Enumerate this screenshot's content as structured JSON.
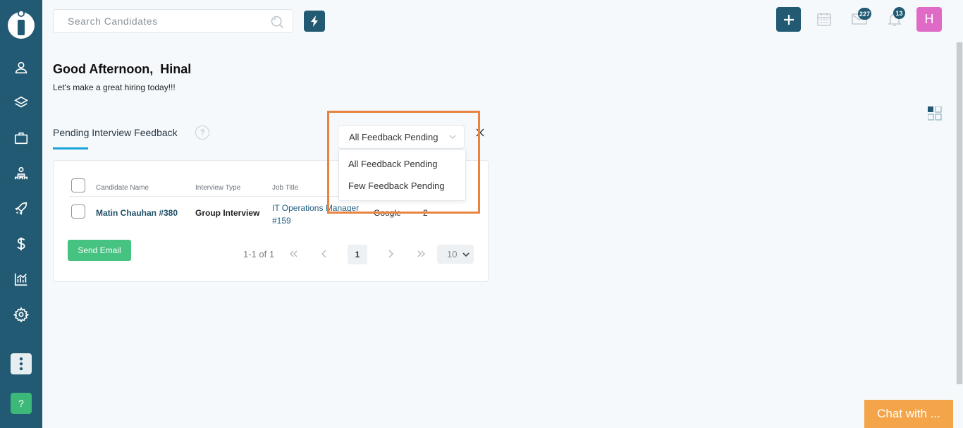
{
  "header": {
    "search_placeholder": "Search Candidates",
    "mail_badge": "227",
    "notification_badge": "13",
    "avatar_initial": "H"
  },
  "greeting": {
    "title": "Good Afternoon,  Hinal",
    "subtitle": "Let's make a great hiring today!!!"
  },
  "widget": {
    "title": "Pending Interview Feedback",
    "info_glyph": "?",
    "filter": {
      "selected": "All Feedback Pending",
      "options": [
        "All Feedback Pending",
        "Few Feedback Pending"
      ]
    },
    "table": {
      "headers": [
        "Candidate Name",
        "Interview Type",
        "Job Title"
      ],
      "rows": [
        {
          "candidate": "Matin Chauhan #380",
          "interview_type": "Group Interview",
          "job_title_line1": "IT Operations Manager",
          "job_title_line2": "#159",
          "company": "Google",
          "count": "2"
        }
      ]
    },
    "send_email_label": "Send Email",
    "pagination": {
      "summary": "1-1 of 1",
      "current_page": "1",
      "per_page": "10"
    }
  },
  "sidebar_help_glyph": "?",
  "chat_label": "Chat with ...",
  "colors": {
    "sidebar": "#215a72",
    "accent_underline": "#1aa3d8",
    "send_button": "#46c281",
    "avatar": "#e06bc6",
    "highlight": "#e8843f",
    "chat": "#f5a549"
  },
  "icons": [
    "app-logo-icon",
    "person-icon",
    "layers-icon",
    "briefcase-icon",
    "team-icon",
    "rocket-icon",
    "dollar-icon",
    "analytics-icon",
    "gear-icon",
    "more-vertical-icon",
    "help-icon",
    "search-icon",
    "bolt-icon",
    "plus-icon",
    "calendar-icon",
    "mail-icon",
    "bell-icon",
    "grid-icon",
    "chevron-down-icon",
    "close-icon"
  ]
}
